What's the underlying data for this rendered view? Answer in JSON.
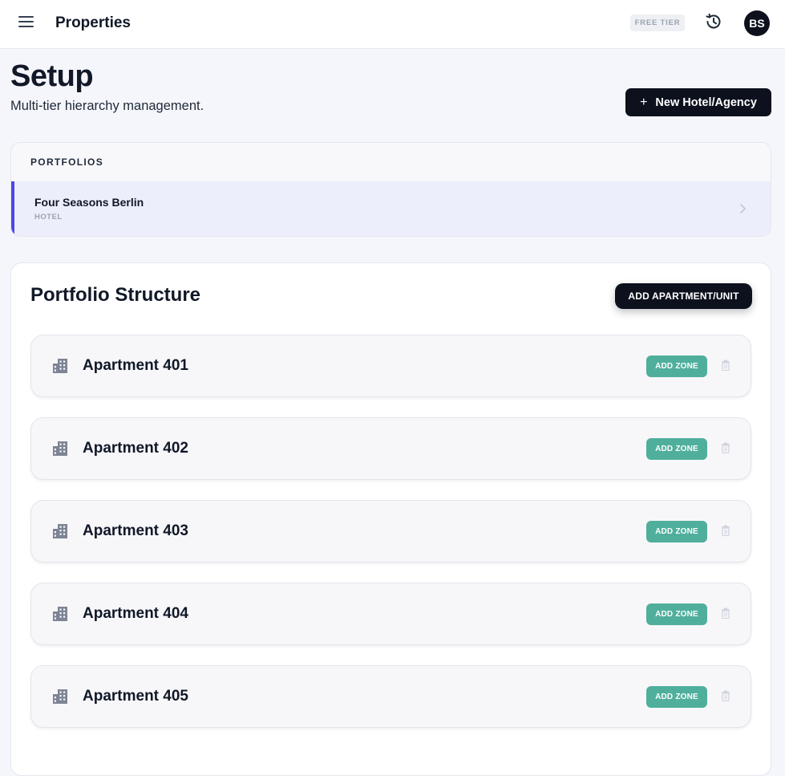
{
  "topbar": {
    "menu_icon": "hamburger-menu-icon",
    "title": "Properties",
    "tier_badge": "FREE TIER",
    "history_icon": "history-icon",
    "avatar_initials": "BS"
  },
  "header": {
    "title": "Setup",
    "subtitle": "Multi-tier hierarchy management.",
    "new_button_icon": "plus-icon",
    "new_button_label": "New Hotel/Agency"
  },
  "portfolios": {
    "heading": "PORTFOLIOS",
    "items": [
      {
        "name": "Four Seasons Berlin",
        "type": "HOTEL",
        "selected": true
      }
    ]
  },
  "structure": {
    "title": "Portfolio Structure",
    "add_button_label": "ADD APARTMENT/UNIT",
    "units": [
      {
        "name": "Apartment 401",
        "add_zone_label": "ADD ZONE"
      },
      {
        "name": "Apartment 402",
        "add_zone_label": "ADD ZONE"
      },
      {
        "name": "Apartment 403",
        "add_zone_label": "ADD ZONE"
      },
      {
        "name": "Apartment 404",
        "add_zone_label": "ADD ZONE"
      },
      {
        "name": "Apartment 405",
        "add_zone_label": "ADD ZONE"
      }
    ]
  },
  "colors": {
    "accent": "#4f46e5",
    "primary_button": "#0c111d",
    "add_zone": "#4faf9c",
    "background": "#f5f6fc"
  }
}
